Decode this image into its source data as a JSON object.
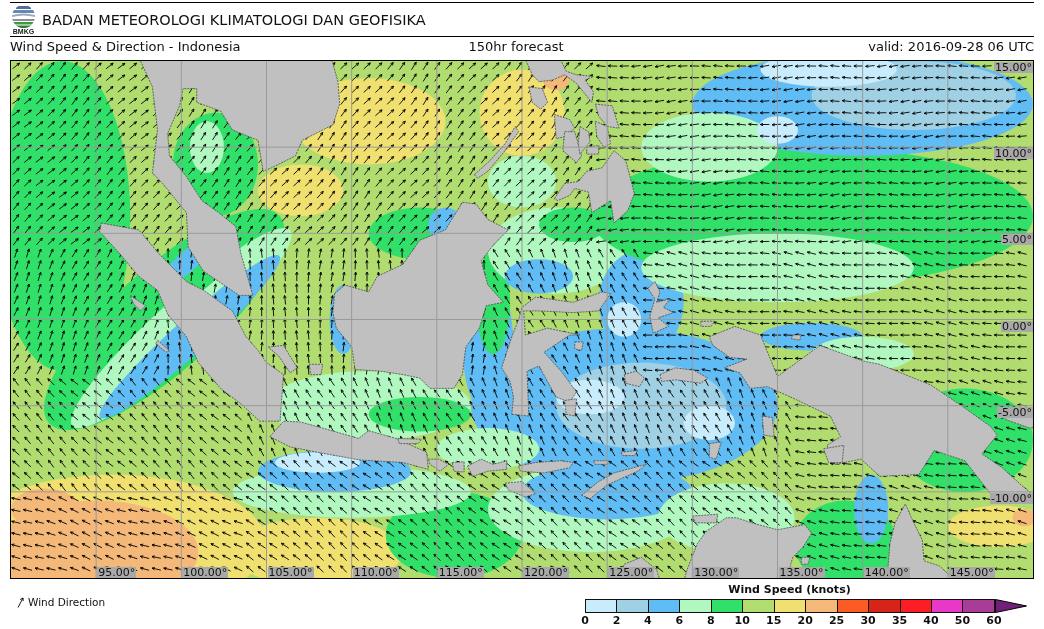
{
  "header": {
    "logo_text": "BMKG",
    "title": "BADAN METEOROLOGI KLIMATOLOGI DAN GEOFISIKA"
  },
  "subheader": {
    "product": "Wind Speed & Direction - Indonesia",
    "forecast": "150hr forecast",
    "valid": "valid: 2016-09-28 06 UTC"
  },
  "map": {
    "latitude_labels": [
      "15.00°",
      "10.00°",
      "5.00°",
      "0.00°",
      "-5.00°",
      "-10.00°"
    ],
    "longitude_labels": [
      "95.00°",
      "100.00°",
      "105.00°",
      "110.00°",
      "115.00°",
      "120.00°",
      "125.00°",
      "130.00°",
      "135.00°",
      "140.00°",
      "145.00°"
    ]
  },
  "legend": {
    "direction_label": "Wind Direction",
    "scale": {
      "title": "Wind Speed (knots)",
      "segments": [
        {
          "kind": "box",
          "color": "#c8ecfc"
        },
        {
          "kind": "box",
          "color": "#a0d0e4"
        },
        {
          "kind": "box",
          "color": "#60bcf4"
        },
        {
          "kind": "box",
          "color": "#b0f8c0"
        },
        {
          "kind": "box",
          "color": "#30e068"
        },
        {
          "kind": "box",
          "color": "#b0dc70"
        },
        {
          "kind": "box",
          "color": "#f0e070"
        },
        {
          "kind": "box",
          "color": "#f4b878"
        },
        {
          "kind": "box",
          "color": "#fc5c24"
        },
        {
          "kind": "box",
          "color": "#d82418"
        },
        {
          "kind": "box",
          "color": "#fc1c24"
        },
        {
          "kind": "box",
          "color": "#e838c8"
        },
        {
          "kind": "box",
          "color": "#a83c98"
        },
        {
          "kind": "arrow",
          "color": "#702078"
        }
      ],
      "ticks": [
        "0",
        "2",
        "4",
        "6",
        "8",
        "10",
        "15",
        "20",
        "25",
        "30",
        "35",
        "40",
        "50",
        "60"
      ]
    }
  }
}
